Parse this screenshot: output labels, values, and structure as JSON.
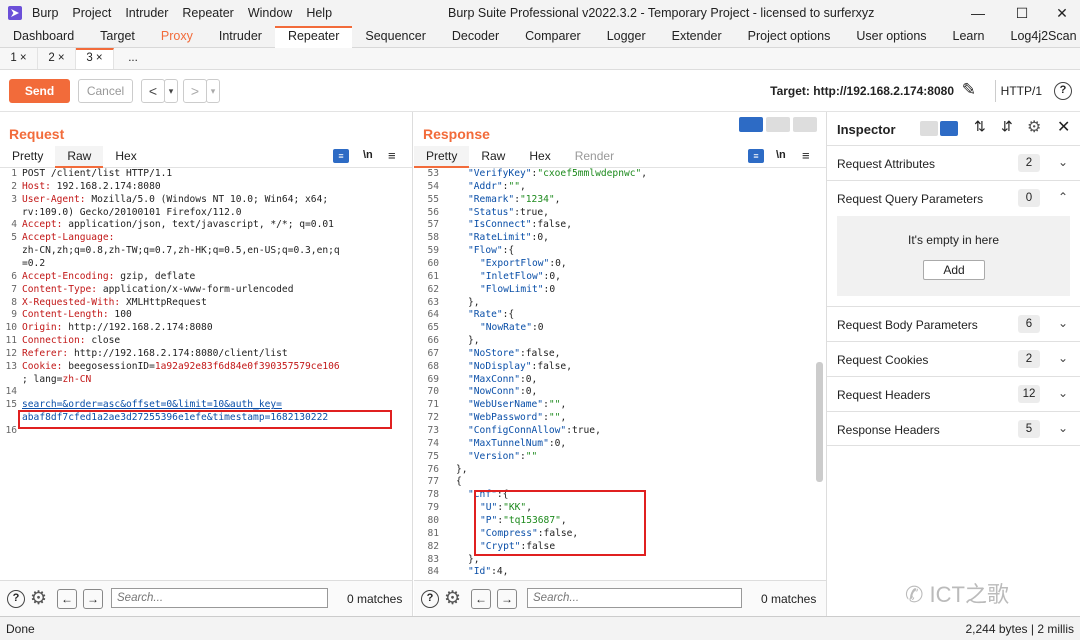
{
  "window": {
    "menu": [
      "Burp",
      "Project",
      "Intruder",
      "Repeater",
      "Window",
      "Help"
    ],
    "title": "Burp Suite Professional v2022.3.2 - Temporary Project - licensed to surferxyz"
  },
  "tabs": [
    "Dashboard",
    "Target",
    "Proxy",
    "Intruder",
    "Repeater",
    "Sequencer",
    "Decoder",
    "Comparer",
    "Logger",
    "Extender",
    "Project options",
    "User options",
    "Learn",
    "Log4j2Scan"
  ],
  "subtabs": [
    "1 ×",
    "2 ×",
    "3 ×",
    "..."
  ],
  "toolbar": {
    "send": "Send",
    "cancel": "Cancel",
    "back": "<",
    "back_menu": "▾",
    "fwd": ">",
    "fwd_menu": "▾",
    "target": "Target: http://192.168.2.174:8080",
    "http_version": "HTTP/1",
    "help": "?"
  },
  "request": {
    "title": "Request",
    "view_tabs": [
      "Pretty",
      "Raw",
      "Hex"
    ],
    "active_tab": "Raw",
    "search_placeholder": "Search...",
    "matches": "0 matches",
    "lines": [
      {
        "n": "1",
        "plain": "POST /client/list HTTP/1.1"
      },
      {
        "n": "2",
        "k": "Host:",
        "v": " 192.168.2.174:8080"
      },
      {
        "n": "3",
        "k": "User-Agent:",
        "v": " Mozilla/5.0 (Windows NT 10.0; Win64; x64;"
      },
      {
        "n": "",
        "v": "rv:109.0) Gecko/20100101 Firefox/112.0"
      },
      {
        "n": "4",
        "k": "Accept:",
        "v": " application/json, text/javascript, */*; q=0.01"
      },
      {
        "n": "5",
        "k": "Accept-Language:",
        "v": ""
      },
      {
        "n": "",
        "v": "zh-CN,zh;q=0.8,zh-TW;q=0.7,zh-HK;q=0.5,en-US;q=0.3,en;q"
      },
      {
        "n": "",
        "v": "=0.2"
      },
      {
        "n": "6",
        "k": "Accept-Encoding:",
        "v": " gzip, deflate"
      },
      {
        "n": "7",
        "k": "Content-Type:",
        "v": " application/x-www-form-urlencoded"
      },
      {
        "n": "8",
        "k": "X-Requested-With:",
        "v": " XMLHttpRequest"
      },
      {
        "n": "9",
        "k": "Content-Length:",
        "v": " 100"
      },
      {
        "n": "10",
        "k": "Origin:",
        "v": " http://192.168.2.174:8080"
      },
      {
        "n": "11",
        "k": "Connection:",
        "v": " close"
      },
      {
        "n": "12",
        "k": "Referer:",
        "v": " http://192.168.2.174:8080/client/list"
      },
      {
        "n": "13",
        "k": "Cookie:",
        "v": " beegosessionID=",
        "s": "1a92a92e83f6d84e0f390357579ce106"
      },
      {
        "n": "",
        "v": "; lang=",
        "s": "zh-CN"
      },
      {
        "n": "14",
        "plain": ""
      },
      {
        "n": "15",
        "body1": "search=&order=asc&offset=0&limit=10&auth_key="
      },
      {
        "n": "",
        "body2": "abaf8df7cfed1a2ae3d27255396e1efe&timestamp=1682130222"
      },
      {
        "n": "16",
        "plain": ""
      }
    ]
  },
  "response": {
    "title": "Response",
    "view_tabs": [
      "Pretty",
      "Raw",
      "Hex",
      "Render"
    ],
    "active_tab": "Pretty",
    "search_placeholder": "Search...",
    "matches": "0 matches",
    "lines": [
      {
        "n": "53",
        "i": 3,
        "k": "\"VerifyKey\"",
        "p": ":",
        "s": "\"cxoef5mmlwdepnwc\"",
        "e": ","
      },
      {
        "n": "54",
        "i": 3,
        "k": "\"Addr\"",
        "p": ":",
        "s": "\"\"",
        "e": ","
      },
      {
        "n": "55",
        "i": 3,
        "k": "\"Remark\"",
        "p": ":",
        "s": "\"1234\"",
        "e": ","
      },
      {
        "n": "56",
        "i": 3,
        "k": "\"Status\"",
        "p": ":true,"
      },
      {
        "n": "57",
        "i": 3,
        "k": "\"IsConnect\"",
        "p": ":false,"
      },
      {
        "n": "58",
        "i": 3,
        "k": "\"RateLimit\"",
        "p": ":0,"
      },
      {
        "n": "59",
        "i": 3,
        "k": "\"Flow\"",
        "p": ":{"
      },
      {
        "n": "60",
        "i": 4,
        "k": "\"ExportFlow\"",
        "p": ":0,"
      },
      {
        "n": "61",
        "i": 4,
        "k": "\"InletFlow\"",
        "p": ":0,"
      },
      {
        "n": "62",
        "i": 4,
        "k": "\"FlowLimit\"",
        "p": ":0"
      },
      {
        "n": "63",
        "i": 3,
        "p": "},"
      },
      {
        "n": "64",
        "i": 3,
        "k": "\"Rate\"",
        "p": ":{"
      },
      {
        "n": "65",
        "i": 4,
        "k": "\"NowRate\"",
        "p": ":0"
      },
      {
        "n": "66",
        "i": 3,
        "p": "},"
      },
      {
        "n": "67",
        "i": 3,
        "k": "\"NoStore\"",
        "p": ":false,"
      },
      {
        "n": "68",
        "i": 3,
        "k": "\"NoDisplay\"",
        "p": ":false,"
      },
      {
        "n": "69",
        "i": 3,
        "k": "\"MaxConn\"",
        "p": ":0,"
      },
      {
        "n": "70",
        "i": 3,
        "k": "\"NowConn\"",
        "p": ":0,"
      },
      {
        "n": "71",
        "i": 3,
        "k": "\"WebUserName\"",
        "p": ":",
        "s": "\"\"",
        "e": ","
      },
      {
        "n": "72",
        "i": 3,
        "k": "\"WebPassword\"",
        "p": ":",
        "s": "\"\"",
        "e": ","
      },
      {
        "n": "73",
        "i": 3,
        "k": "\"ConfigConnAllow\"",
        "p": ":true,"
      },
      {
        "n": "74",
        "i": 3,
        "k": "\"MaxTunnelNum\"",
        "p": ":0,"
      },
      {
        "n": "75",
        "i": 3,
        "k": "\"Version\"",
        "p": ":",
        "s": "\"\""
      },
      {
        "n": "76",
        "i": 2,
        "p": "},"
      },
      {
        "n": "77",
        "i": 2,
        "p": "{"
      },
      {
        "n": "78",
        "i": 3,
        "k": "\"Cnf\"",
        "p": ":{"
      },
      {
        "n": "79",
        "i": 4,
        "k": "\"U\"",
        "p": ":",
        "s": "\"KK\"",
        "e": ","
      },
      {
        "n": "80",
        "i": 4,
        "k": "\"P\"",
        "p": ":",
        "s": "\"tq153687\"",
        "e": ","
      },
      {
        "n": "81",
        "i": 4,
        "k": "\"Compress\"",
        "p": ":false,"
      },
      {
        "n": "82",
        "i": 4,
        "k": "\"Crypt\"",
        "p": ":false"
      },
      {
        "n": "83",
        "i": 3,
        "p": "},"
      },
      {
        "n": "84",
        "i": 3,
        "k": "\"Id\"",
        "p": ":4,"
      }
    ]
  },
  "inspector": {
    "title": "Inspector",
    "empty_text": "It's empty in here",
    "add_label": "Add",
    "sections": [
      {
        "label": "Request Attributes",
        "count": "2",
        "chev": "⌄"
      },
      {
        "label": "Request Query Parameters",
        "count": "0",
        "chev": "⌃"
      },
      {
        "label": "Request Body Parameters",
        "count": "6",
        "chev": "⌄"
      },
      {
        "label": "Request Cookies",
        "count": "2",
        "chev": "⌄"
      },
      {
        "label": "Request Headers",
        "count": "12",
        "chev": "⌄"
      },
      {
        "label": "Response Headers",
        "count": "5",
        "chev": "⌄"
      }
    ]
  },
  "status": {
    "left": "Done",
    "right": "2,244 bytes | 2 millis"
  },
  "watermark": "ICT之歌"
}
